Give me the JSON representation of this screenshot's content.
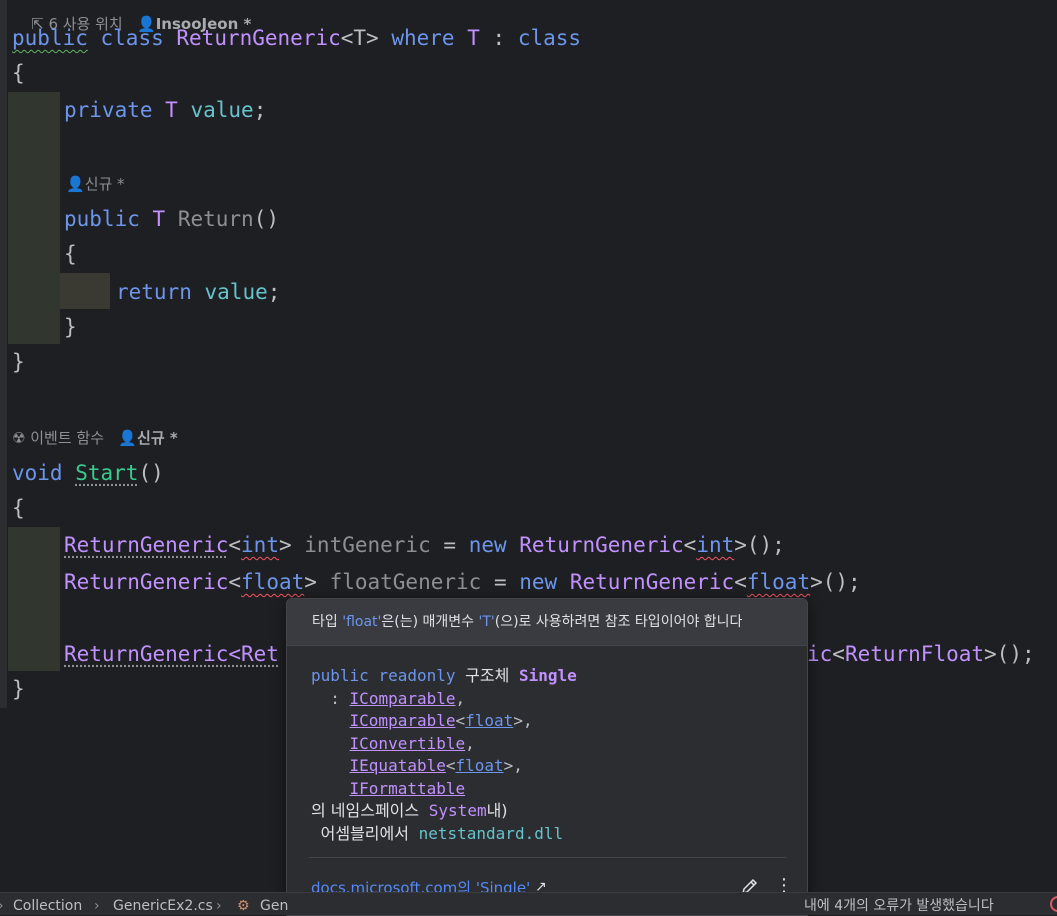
{
  "editor": {
    "hint_top": {
      "usages": "6 사용 위치",
      "author": "InsooJeon *"
    },
    "class_decl": {
      "public": "public",
      "class": "class",
      "name": "ReturnGeneric",
      "generic": "<T>",
      "where": "where",
      "t": "T",
      "colon": ":",
      "constraint": "class"
    },
    "open_brace": "{",
    "field": {
      "private": "private",
      "type": "T",
      "name": "value",
      "semi": ";"
    },
    "hint_method": {
      "author": "신규 *"
    },
    "method": {
      "public": "public",
      "type": "T",
      "name": "Return",
      "parens": "()"
    },
    "method_open": "{",
    "return_stmt": {
      "return": "return",
      "value": "value",
      "semi": ";"
    },
    "method_close": "}",
    "class_close": "}",
    "hint_start": {
      "kind": "이벤트 함수",
      "author": "신규 *"
    },
    "start_decl": {
      "void": "void",
      "name": "Start",
      "parens": "()"
    },
    "start_open": "{",
    "line_int": {
      "type": "ReturnGeneric",
      "lt": "<",
      "arg": "int",
      "gt": ">",
      "var": "intGeneric",
      "eq": "=",
      "new": "new",
      "type2": "ReturnGeneric",
      "lt2": "<",
      "arg2": "int",
      "end": ">();"
    },
    "line_float": {
      "type": "ReturnGeneric",
      "lt": "<",
      "arg": "float",
      "gt": ">",
      "var": "floatGeneric",
      "eq": "=",
      "new": "new",
      "type2": "ReturnGeneric",
      "lt2": "<",
      "arg2": "float",
      "end": ">();"
    },
    "line_rf": {
      "start": "ReturnGeneric<Ret",
      "tail_ic": "ic",
      "lt": "<",
      "arg": "ReturnFloat",
      "end": ">();"
    },
    "start_close": "}"
  },
  "popup": {
    "header": {
      "p1": "타입 ",
      "q1": "'float'",
      "p2": "은(는) 매개변수 ",
      "q2": "'T'",
      "p3": "(으)로 사용하려면 참조 타입이어야 합니다"
    },
    "sig": {
      "public": "public",
      "readonly": "readonly",
      "struct_ko": "구조체",
      "name": "Single",
      "colon": ":",
      "i1": "IComparable",
      "i2": "IComparable",
      "i2_arg": "float",
      "i3": "IConvertible",
      "i4": "IEquatable",
      "i4_arg": "float",
      "i5": "IFormattable",
      "ns_prefix": "의 네임스페이스",
      "ns": "System",
      "ns_suffix": "내)",
      "asm_prefix": "어셈블리에서",
      "asm": "netstandard.dll"
    },
    "doc_link": "docs.microsoft.com의 'Single'",
    "ext_icon": "↗",
    "more_icon": "⋮"
  },
  "statusbar": {
    "crumb1": "Collection",
    "crumb2": "GenericEx2.cs",
    "crumb3": "Gen",
    "errors": "내에 4개의 오류가 발생했습니다"
  }
}
